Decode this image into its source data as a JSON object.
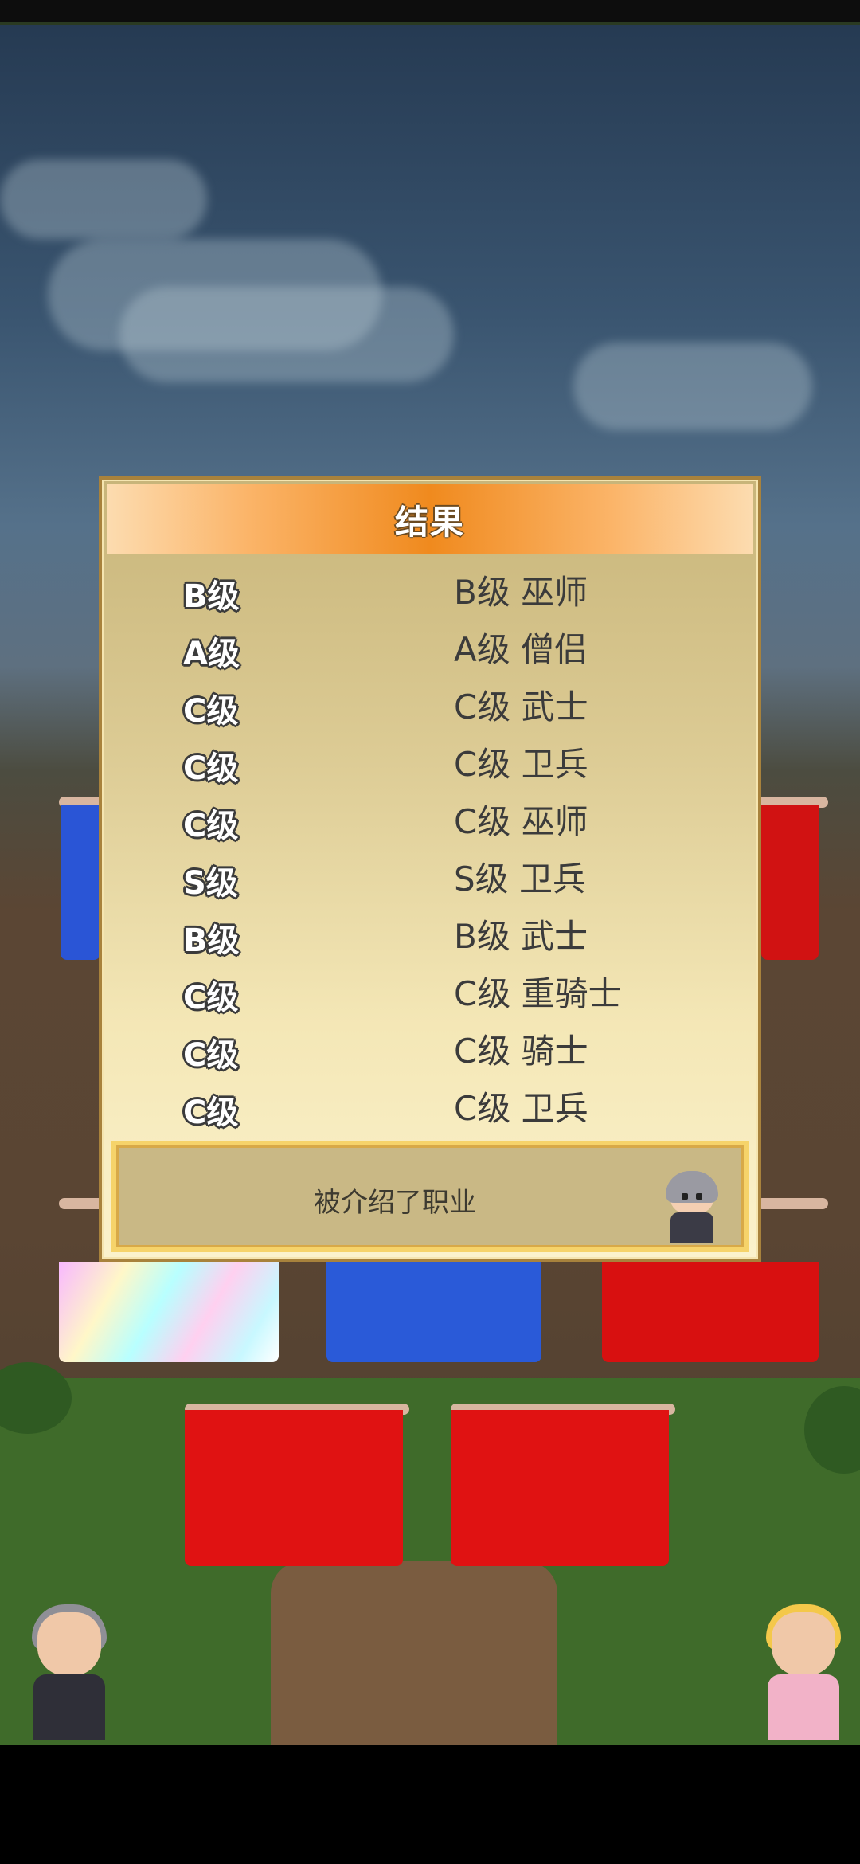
{
  "dialog": {
    "title": "结果",
    "results": [
      {
        "grade": "B级",
        "job": "B级 巫师"
      },
      {
        "grade": "A级",
        "job": "A级 僧侣"
      },
      {
        "grade": "C级",
        "job": "C级 武士"
      },
      {
        "grade": "C级",
        "job": "C级 卫兵"
      },
      {
        "grade": "C级",
        "job": "C级 巫师"
      },
      {
        "grade": "S级",
        "job": "S级 卫兵"
      },
      {
        "grade": "B级",
        "job": "B级 武士"
      },
      {
        "grade": "C级",
        "job": "C级 重骑士"
      },
      {
        "grade": "C级",
        "job": "C级 骑士"
      },
      {
        "grade": "C级",
        "job": "C级 卫兵"
      }
    ],
    "message": "被介绍了职业"
  },
  "colors": {
    "header_accent": "#f08a1e",
    "dialog_border": "#a8823c",
    "footer_border": "#f6d36a"
  }
}
